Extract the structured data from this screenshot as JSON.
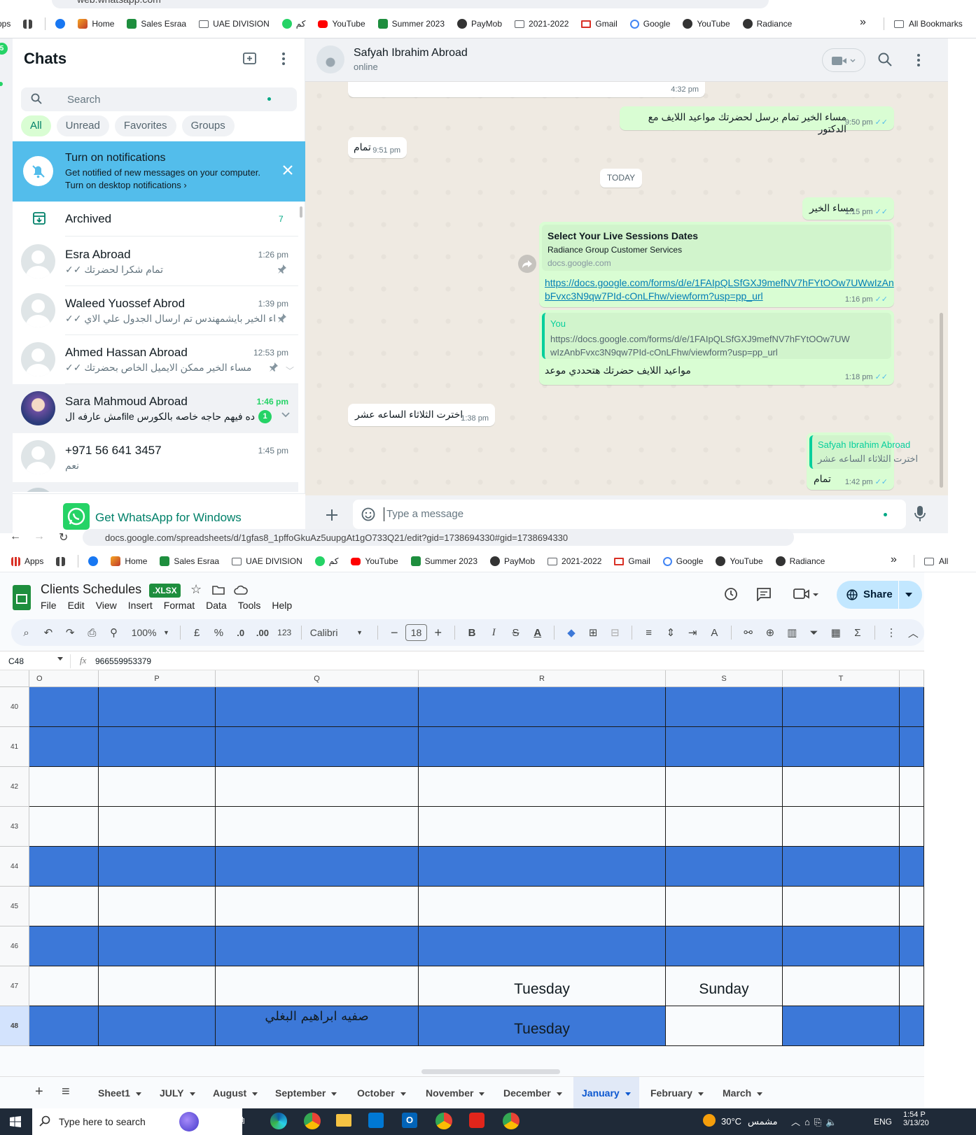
{
  "browser_top": {
    "url": "web.whatsapp.com",
    "bookmarks": [
      {
        "label": "Apps",
        "icon": "apps-grid-icon"
      },
      {
        "label": "",
        "icon": "tab-grid-icon"
      },
      {
        "label": "",
        "icon": "facebook-icon"
      },
      {
        "label": "Home",
        "icon": "home-icon"
      },
      {
        "label": "Sales Esraa",
        "icon": "sheets-icon"
      },
      {
        "label": "UAE DIVISION",
        "icon": "folder-icon"
      },
      {
        "label": "كم",
        "icon": "whatsapp-icon"
      },
      {
        "label": "YouTube",
        "icon": "youtube-icon"
      },
      {
        "label": "Summer 2023",
        "icon": "sheets-icon"
      },
      {
        "label": "PayMob",
        "icon": "globe-icon"
      },
      {
        "label": "2021-2022",
        "icon": "folder-icon"
      },
      {
        "label": "Gmail",
        "icon": "gmail-icon"
      },
      {
        "label": "Google",
        "icon": "google-icon"
      },
      {
        "label": "YouTube",
        "icon": "globe-icon"
      },
      {
        "label": "Radiance",
        "icon": "globe-icon"
      }
    ],
    "more": "»",
    "all_bookmarks": "All Bookmarks"
  },
  "whatsapp": {
    "badge": "5",
    "sidebar_title": "Chats",
    "search_placeholder": "Search",
    "filters": [
      "All",
      "Unread",
      "Favorites",
      "Groups"
    ],
    "notification": {
      "title": "Turn on notifications",
      "line1": "Get notified of new messages on your computer.",
      "line2": "Turn on desktop notifications ›"
    },
    "archived_label": "Archived",
    "archived_count": "7",
    "chats": [
      {
        "name": "Esra Abroad",
        "preview": "✓✓ تمام شكرا لحضرتك",
        "time": "1:26 pm",
        "pinned": true
      },
      {
        "name": "Waleed Yuossef Abrod",
        "preview": "✓✓ مساء الخير بايشمهندس تم ارسال الجدول علي الاي...",
        "time": "1:39 pm",
        "pinned": true
      },
      {
        "name": "Ahmed Hassan Abroad",
        "preview": "✓✓ مساء الخير ممكن الايميل الخاص بحضرتك",
        "time": "12:53 pm",
        "pinned": true
      },
      {
        "name": "Sara Mahmoud Abroad",
        "preview": "مش عارفه الfile ده فيهم حاجه خاصه بالكورس",
        "time": "1:46 pm",
        "unread": "1"
      },
      {
        "name": "+971 56 641 3457",
        "preview": "نعم",
        "time": "1:45 pm"
      }
    ],
    "get_app": "Get WhatsApp for Windows",
    "contact": {
      "name": "Safyah Ibrahim Abroad",
      "status": "online"
    },
    "messages": {
      "m0_time": "4:32 pm",
      "m1_text": "مساء الخير تمام برسل لحضرتك مواعيد اللايف مع الدكتور",
      "m1_time": "9:50 pm",
      "m2_text": "تمام",
      "m2_time": "9:51 pm",
      "day": "TODAY",
      "m3_text": "مساء الخير",
      "m3_time": "1:15 pm",
      "link_title": "Select Your Live Sessions Dates",
      "link_sub": "Radiance Group Customer Services",
      "link_domain": "docs.google.com",
      "link_url1": "https://docs.google.com/forms/d/e/1FAIpQLSfGXJ9mefNV7hFYtOOw7UWwIzAn",
      "link_url2": "bFvxc3N9qw7PId-cOnLFhw/viewform?usp=pp_url",
      "link_time": "1:16 pm",
      "quote_author": "You",
      "quote_line1": "https://docs.google.com/forms/d/e/1FAIpQLSfGXJ9mefNV7hFYtOOw7UW",
      "quote_line2": "wIzAnbFvxc3N9qw7PId-cOnLFhw/viewform?usp=pp_url",
      "m5_text": "مواعيد اللايف حضرتك هتحددي موعد",
      "m5_time": "1:18 pm",
      "m6_text": "اخترت الثلاثاء الساعه عشر",
      "m6_time": "1:38 pm",
      "q2_author": "Safyah Ibrahim Abroad",
      "q2_text": "اخترت الثلاثاء الساعه عشر",
      "m7_text": "تمام",
      "m7_time": "1:42 pm"
    },
    "input_placeholder": "Type a message"
  },
  "sheets": {
    "url": "docs.google.com/spreadsheets/d/1gfas8_1pffoGkuAz5uupgAt1gO733Q21/edit?gid=1738694330#gid=1738694330",
    "doc_title": "Clients Schedules",
    "format_badge": ".XLSX",
    "menus": [
      "File",
      "Edit",
      "View",
      "Insert",
      "Format",
      "Data",
      "Tools",
      "Help"
    ],
    "share": "Share",
    "zoom": "100%",
    "currency": "£",
    "percent": "%",
    "dec_dec": ".0",
    "dec_inc": ".00",
    "num_fmt": "123",
    "font": "Calibri",
    "font_size": "18",
    "name_box": "C48",
    "formula": "966559953379",
    "columns": [
      "O",
      "P",
      "Q",
      "R",
      "S",
      "T"
    ],
    "rows": [
      "40",
      "41",
      "42",
      "43",
      "44",
      "45",
      "46",
      "47",
      "48"
    ],
    "r47_R": "Tuesday",
    "r47_S": "Sunday",
    "r48_Q": "صفيه ابراهيم البغلي",
    "r48_R": "Tuesday",
    "tabs": [
      "Sheet1",
      "JULY",
      "August",
      "September",
      "October",
      "November",
      "December",
      "January",
      "February",
      "March"
    ],
    "active_tab": "January"
  },
  "taskbar": {
    "search": "Type here to search",
    "weather": "30°C",
    "weather_label": "مشمس",
    "lang": "ENG",
    "time": "1:54 P",
    "date": "3/13/20"
  },
  "colors": {
    "wa_green": "#25d366",
    "wa_teal": "#008069",
    "sheet_blue": "#3c78d8",
    "notif_blue": "#53bdeb"
  }
}
